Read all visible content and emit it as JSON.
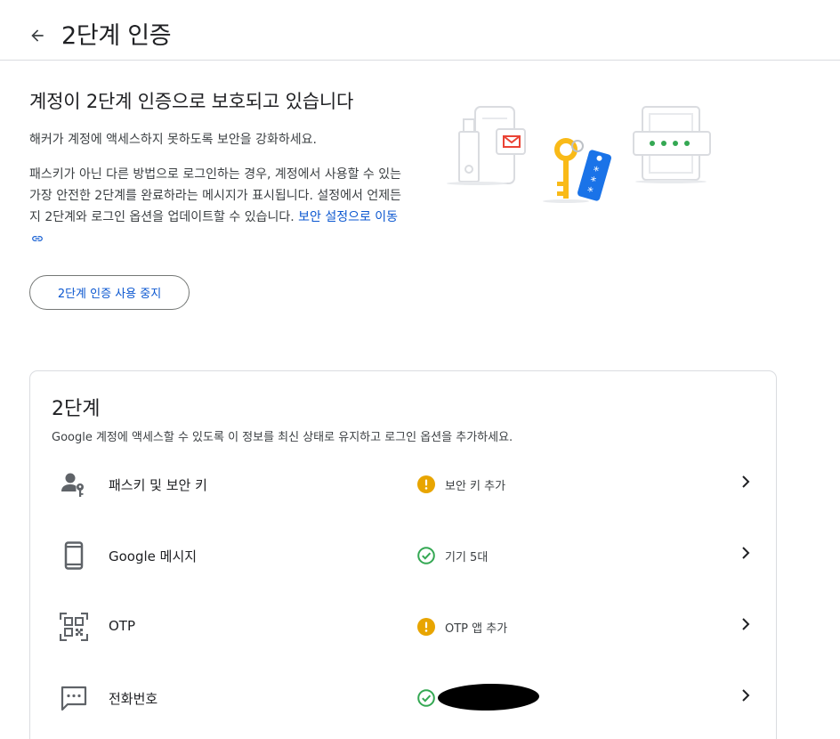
{
  "header": {
    "title": "2단계 인증"
  },
  "status": {
    "heading": "계정이 2단계 인증으로 보호되고 있습니다",
    "subtitle": "해커가 계정에 액세스하지 못하도록 보안을 강화하세요.",
    "description": "패스키가 아닌 다른 방법으로 로그인하는 경우, 계정에서 사용할 수 있는 가장 안전한 2단계를 완료하라는 메시지가 표시됩니다. 설정에서 언제든지 2단계와 로그인 옵션을 업데이트할 수 있습니다. ",
    "link_label": "보안 설정으로 이동",
    "turn_off_label": "2단계 인증 사용 중지"
  },
  "second_steps": {
    "title": "2단계",
    "description": "Google 계정에 액세스할 수 있도록 이 정보를 최신 상태로 유지하고 로그인 옵션을 추가하세요.",
    "rows": [
      {
        "label": "패스키 및 보안 키",
        "icon": "passkey-person-key-icon",
        "status_icon": "warning-icon",
        "status_text": "보안 키 추가"
      },
      {
        "label": "Google 메시지",
        "icon": "phone-icon",
        "status_icon": "check-circle-icon",
        "status_text": "기기 5대"
      },
      {
        "label": "OTP",
        "icon": "qr-code-icon",
        "status_icon": "warning-icon",
        "status_text": "OTP 앱 추가"
      },
      {
        "label": "전화번호",
        "icon": "sms-message-icon",
        "status_icon": "check-circle-icon",
        "status_text": ""
      }
    ]
  },
  "colors": {
    "accent_blue": "#0b57d0",
    "warning_orange": "#e8a500",
    "success_green": "#34a853",
    "key_yellow": "#f9ba18",
    "border_grey": "#dadce0"
  }
}
